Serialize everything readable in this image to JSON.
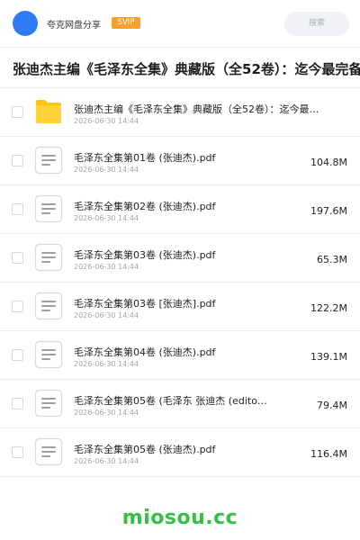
{
  "header": {
    "user_name": "夸克网盘分享",
    "badge": "SVIP",
    "search_label": "搜索"
  },
  "page_title": "张迪杰主编《毛泽东全集》典藏版（全52卷）：迄今最完备",
  "files": [
    {
      "type": "folder",
      "name": "张迪杰主编《毛泽东全集》典藏版（全52卷）：迄今最…",
      "date": "2026-06-30 14:44",
      "size": ""
    },
    {
      "type": "pdf",
      "name": "毛泽东全集第01卷 (张迪杰).pdf",
      "date": "2026-06-30 14:44",
      "size": "104.8M"
    },
    {
      "type": "pdf",
      "name": "毛泽东全集第02卷 (张迪杰).pdf",
      "date": "2026-06-30 14:44",
      "size": "197.6M"
    },
    {
      "type": "pdf",
      "name": "毛泽东全集第03卷 (张迪杰).pdf",
      "date": "2026-06-30 14:44",
      "size": "65.3M"
    },
    {
      "type": "pdf",
      "name": "毛泽东全集第03卷 [张迪杰].pdf",
      "date": "2026-06-30 14:44",
      "size": "122.2M"
    },
    {
      "type": "pdf",
      "name": "毛泽东全集第04卷 (张迪杰).pdf",
      "date": "2026-06-30 14:44",
      "size": "139.1M"
    },
    {
      "type": "pdf",
      "name": "毛泽东全集第05卷 (毛泽东 张迪杰 (edito…",
      "date": "2026-06-30 14:44",
      "size": "79.4M"
    },
    {
      "type": "pdf",
      "name": "毛泽东全集第05卷 (张迪杰).pdf",
      "date": "2026-06-30 14:44",
      "size": "116.4M"
    }
  ],
  "watermark": "miosou.cc",
  "colors": {
    "avatar": "#2f7bf5",
    "svip": "#f8a02a",
    "folder": "#ffc61a",
    "watermark": "#35c043"
  }
}
